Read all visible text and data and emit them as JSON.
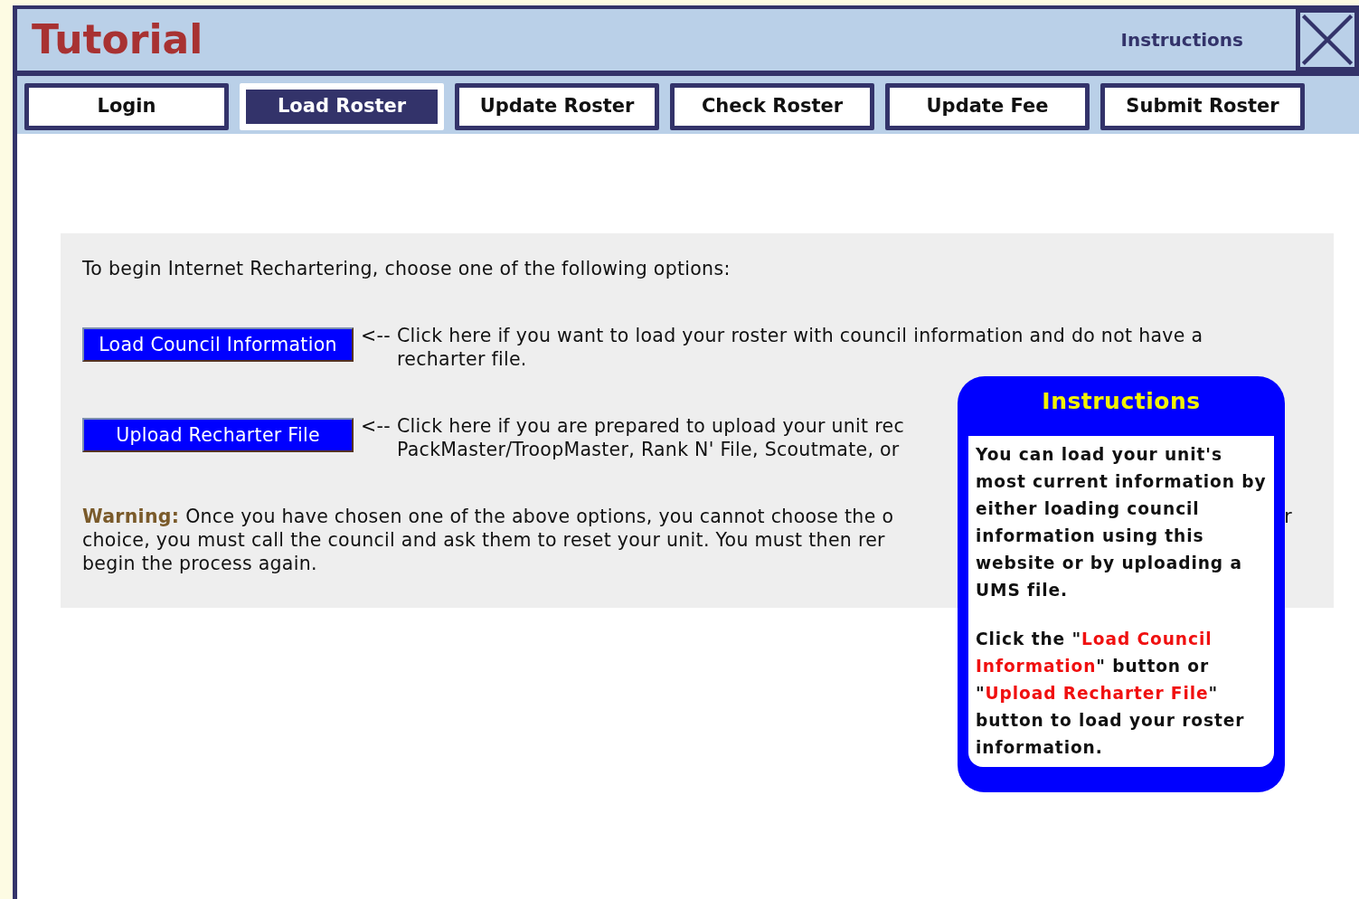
{
  "header": {
    "title": "Tutorial",
    "link": "Instructions"
  },
  "tabs": [
    {
      "label": "Login",
      "selected": false
    },
    {
      "label": "Load Roster",
      "selected": true
    },
    {
      "label": "Update Roster",
      "selected": false
    },
    {
      "label": "Check Roster",
      "selected": false
    },
    {
      "label": "Update Fee",
      "selected": false
    },
    {
      "label": "Submit Roster",
      "selected": false
    }
  ],
  "panel": {
    "intro": "To begin Internet Rechartering, choose one of the following options:",
    "options": [
      {
        "button": "Load Council Information",
        "arrow": "<--",
        "lines": [
          "Click here if you want to load your roster with council information and do not have a",
          "recharter file."
        ]
      },
      {
        "button": "Upload Recharter File",
        "arrow": "<--",
        "lines": [
          "Click here if you are prepared to upload your unit rec",
          "PackMaster/TroopMaster, Rank N' File, Scoutmate, or"
        ]
      }
    ],
    "warning": {
      "label": "Warning:",
      "lines": [
        "Once you have chosen one of the above options, you cannot choose the o",
        "choice, you must call the council and ask them to reset your unit. You must then rer",
        "begin the process again."
      ],
      "edge_text": "r"
    }
  },
  "popup": {
    "title": "Instructions",
    "paragraphs": [
      [
        {
          "text": "You can load your unit's most current information by either loading council information using this website or by uploading a UMS file.",
          "highlight": false
        }
      ],
      [
        {
          "text": "Click the \"",
          "highlight": false
        },
        {
          "text": "Load Council Information",
          "highlight": true
        },
        {
          "text": "\" button or \"",
          "highlight": false
        },
        {
          "text": "Upload Recharter File",
          "highlight": true
        },
        {
          "text": "\" button to load your roster information.",
          "highlight": false
        }
      ]
    ]
  }
}
